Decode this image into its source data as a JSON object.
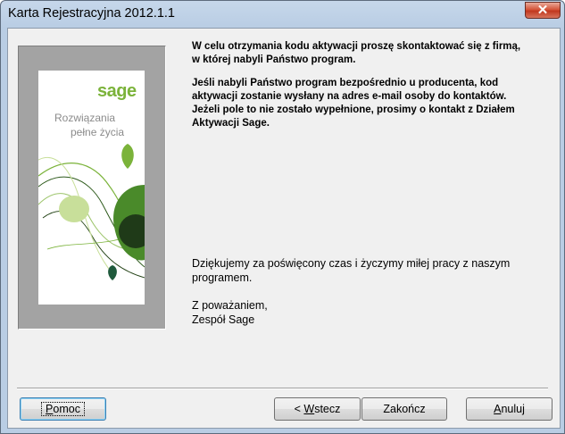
{
  "window": {
    "title": "Karta Rejestracyjna 2012.1.1",
    "close_glyph": "✕"
  },
  "brand": {
    "logo": "sage",
    "tagline_line1": "Rozwiązania",
    "tagline_line2": "pełne życia"
  },
  "message": {
    "para1_line1": "W celu otrzymania kodu aktywacji proszę skontaktować się z firmą,",
    "para1_line2": "w której nabyli Państwo program.",
    "para2_line1": "Jeśli nabyli Państwo program bezpośrednio u producenta, kod",
    "para2_line2": "aktywacji zostanie wysłany na adres e-mail osoby do kontaktów.",
    "para2_line3": "Jeżeli pole to nie zostało wypełnione, prosimy o kontakt z Działem",
    "para2_line4": "Aktywacji Sage.",
    "thanks_line1": "Dziękujemy za poświęcony czas i życzymy miłej pracy z naszym",
    "thanks_line2": "programem.",
    "closing_line1": "Z poważaniem,",
    "closing_line2": "Zespół Sage"
  },
  "buttons": {
    "help_key": "P",
    "help_rest": "omoc",
    "back_prefix": "< ",
    "back_key": "W",
    "back_rest": "stecz",
    "finish": "Zakończ",
    "cancel_key": "A",
    "cancel_rest": "nuluj"
  },
  "colors": {
    "sage_green": "#7bb33a",
    "dark_green": "#2d5a1b",
    "light_green": "#c8df9a"
  }
}
